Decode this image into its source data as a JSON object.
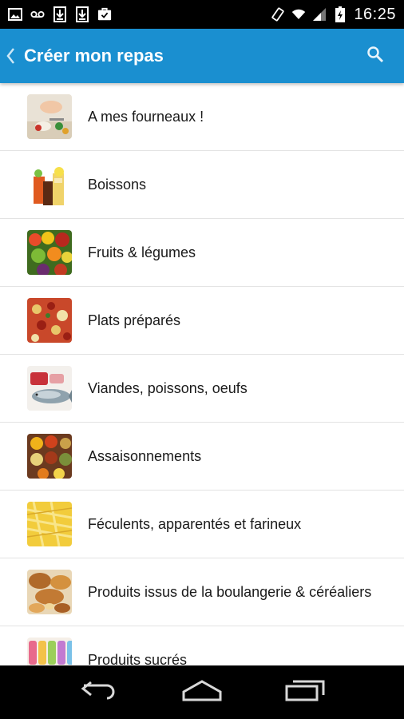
{
  "status_bar": {
    "time": "16:25",
    "left_icons": [
      "image-icon",
      "voicemail-icon",
      "download-icon",
      "download-icon",
      "briefcase-check-icon"
    ],
    "right_icons": [
      "screen-rotation-icon",
      "wifi-icon",
      "signal-icon",
      "battery-charging-icon"
    ]
  },
  "action_bar": {
    "title": "Créer mon repas",
    "color": "#1a8fd0",
    "back_icon": "chevron-left-icon",
    "search_icon": "search-icon"
  },
  "categories": [
    {
      "label": "A mes fourneaux !",
      "icon": "cooking-photo"
    },
    {
      "label": "Boissons",
      "icon": "drinks-photo"
    },
    {
      "label": "Fruits & légumes",
      "icon": "vegetables-photo"
    },
    {
      "label": "Plats préparés",
      "icon": "pizza-photo"
    },
    {
      "label": "Viandes, poissons, oeufs",
      "icon": "fish-meat-photo"
    },
    {
      "label": "Assaisonnements",
      "icon": "spices-photo"
    },
    {
      "label": "Féculents, apparentés et farineux",
      "icon": "pasta-photo"
    },
    {
      "label": "Produits issus de la boulangerie & céréaliers",
      "icon": "bread-photo"
    },
    {
      "label": "Produits sucrés",
      "icon": "macarons-photo"
    }
  ],
  "nav_bar": {
    "icons": [
      "back-nav-icon",
      "home-nav-icon",
      "recent-apps-icon"
    ]
  }
}
